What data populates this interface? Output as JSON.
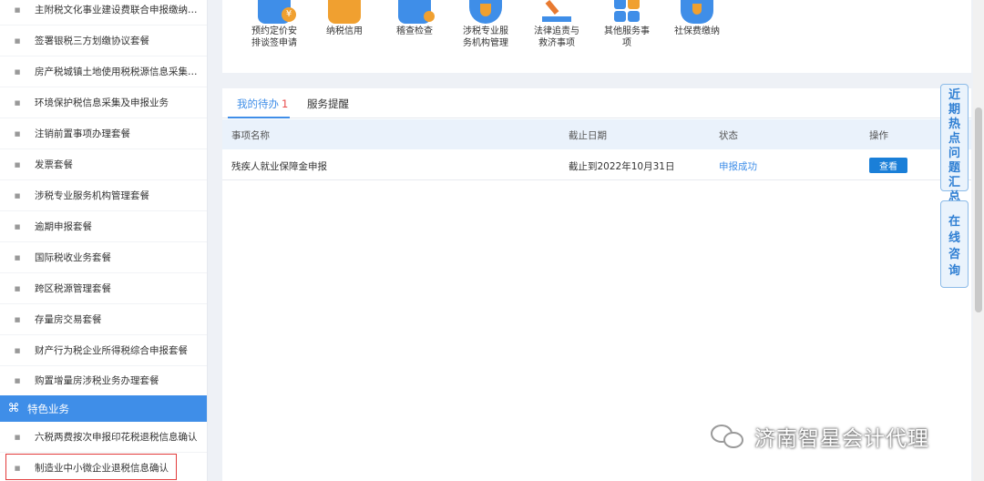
{
  "sidebar": {
    "items": [
      "主附税文化事业建设费联合申报缴纳套餐",
      "签署银税三方划缴协议套餐",
      "房产税城镇土地使用税税源信息采集及申...",
      "环境保护税信息采集及申报业务",
      "注销前置事项办理套餐",
      "发票套餐",
      "涉税专业服务机构管理套餐",
      "逾期申报套餐",
      "国际税收业务套餐",
      "跨区税源管理套餐",
      "存量房交易套餐",
      "财产行为税企业所得税综合申报套餐",
      "购置增量房涉税业务办理套餐"
    ],
    "section_header": "特色业务",
    "section_items": [
      "六税两费按次申报印花税退税信息确认",
      "制造业中小微企业退税信息确认"
    ]
  },
  "services": [
    {
      "label": "预约定价安排谈签申请",
      "icon": "contract-icon",
      "color": "#3f8ee8"
    },
    {
      "label": "纳税信用",
      "icon": "credit-icon",
      "color": "#f0a030"
    },
    {
      "label": "稽查检查",
      "icon": "inspection-icon",
      "color": "#3f8ee8"
    },
    {
      "label": "涉税专业服务机构管理",
      "icon": "umbrella-icon",
      "color": "#f0a030"
    },
    {
      "label": "法律追责与救济事项",
      "icon": "gavel-icon",
      "color": "#e87a30"
    },
    {
      "label": "其他服务事项",
      "icon": "grid-icon",
      "color": "#3f8ee8"
    },
    {
      "label": "社保费缴纳",
      "icon": "shield-hand-icon",
      "color": "#3f8ee8"
    }
  ],
  "todo": {
    "tabs": [
      {
        "label": "我的待办",
        "count": "1"
      },
      {
        "label": "服务提醒"
      }
    ],
    "columns": [
      "事项名称",
      "截止日期",
      "状态",
      "操作"
    ],
    "rows": [
      {
        "name": "残疾人就业保障金申报",
        "deadline": "截止到2022年10月31日",
        "status": "申报成功",
        "action": "查看"
      }
    ]
  },
  "float_tabs": [
    "近期热点问题汇总",
    "在线咨询"
  ],
  "watermark": "济南智星会计代理"
}
